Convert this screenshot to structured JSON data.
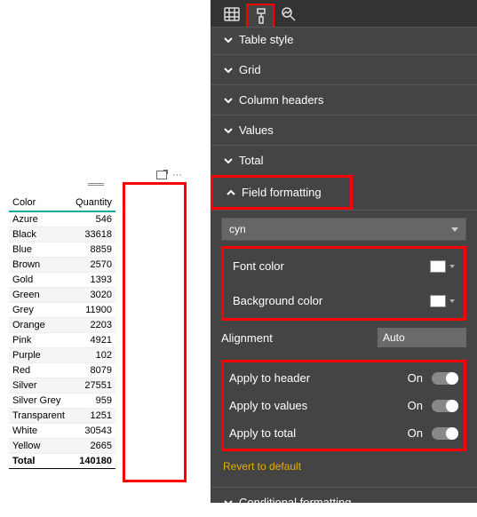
{
  "table": {
    "cols": [
      "Color",
      "Quantity"
    ],
    "rows": [
      {
        "c": "Azure",
        "q": "546"
      },
      {
        "c": "Black",
        "q": "33618"
      },
      {
        "c": "Blue",
        "q": "8859"
      },
      {
        "c": "Brown",
        "q": "2570"
      },
      {
        "c": "Gold",
        "q": "1393"
      },
      {
        "c": "Green",
        "q": "3020"
      },
      {
        "c": "Grey",
        "q": "11900"
      },
      {
        "c": "Orange",
        "q": "2203"
      },
      {
        "c": "Pink",
        "q": "4921"
      },
      {
        "c": "Purple",
        "q": "102"
      },
      {
        "c": "Red",
        "q": "8079"
      },
      {
        "c": "Silver",
        "q": "27551"
      },
      {
        "c": "Silver Grey",
        "q": "959"
      },
      {
        "c": "Transparent",
        "q": "1251"
      },
      {
        "c": "White",
        "q": "30543"
      },
      {
        "c": "Yellow",
        "q": "2665"
      }
    ],
    "total_label": "Total",
    "total_value": "140180"
  },
  "panel": {
    "sections": {
      "table_style": "Table style",
      "grid": "Grid",
      "column_headers": "Column headers",
      "values": "Values",
      "total": "Total",
      "field_formatting": "Field formatting",
      "conditional_formatting": "Conditional formatting"
    },
    "field_dropdown": "cyn",
    "font_color": "Font color",
    "background_color": "Background color",
    "alignment_label": "Alignment",
    "alignment_value": "Auto",
    "apply_header": "Apply to header",
    "apply_values": "Apply to values",
    "apply_total": "Apply to total",
    "on": "On",
    "revert": "Revert to default"
  }
}
